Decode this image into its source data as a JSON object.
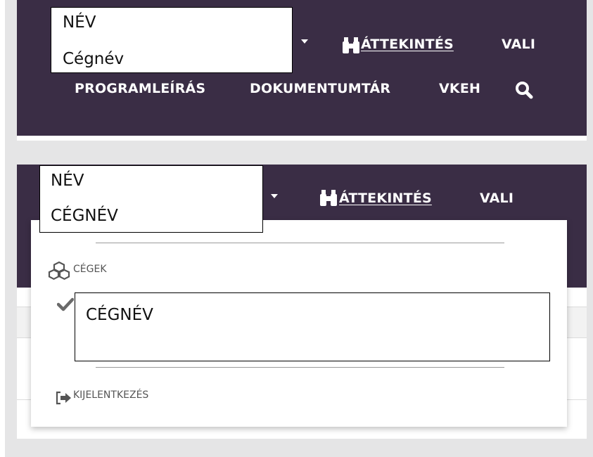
{
  "top_screenshot": {
    "name_box": {
      "line1": "NÉV",
      "line2": "Cégnév"
    },
    "nav": {
      "overview_label": "ÁTTEKINTÉS",
      "vali_label": "VALI",
      "program_label": "PROGRAMLEÍRÁS",
      "documents_label": "DOKUMENTUMTÁR",
      "vkeh_label": "VKEH"
    }
  },
  "bottom_screenshot": {
    "name_box": {
      "line1": "NÉV",
      "line2": "CÉGNÉV"
    },
    "nav": {
      "overview_label": "ÁTTEKINTÉS",
      "vali_label": "VALI"
    },
    "dropdown": {
      "companies_label": "CÉGEK",
      "selected_company": "CÉGNÉV",
      "logout_label": "KIJELENTKEZÉS"
    }
  },
  "colors": {
    "nav_background": "#3a2d45",
    "page_gray": "#e5e5e6"
  },
  "icons": [
    "caret-down-icon",
    "binoculars-icon",
    "search-icon",
    "cubes-icon",
    "check-icon",
    "logout-icon"
  ]
}
